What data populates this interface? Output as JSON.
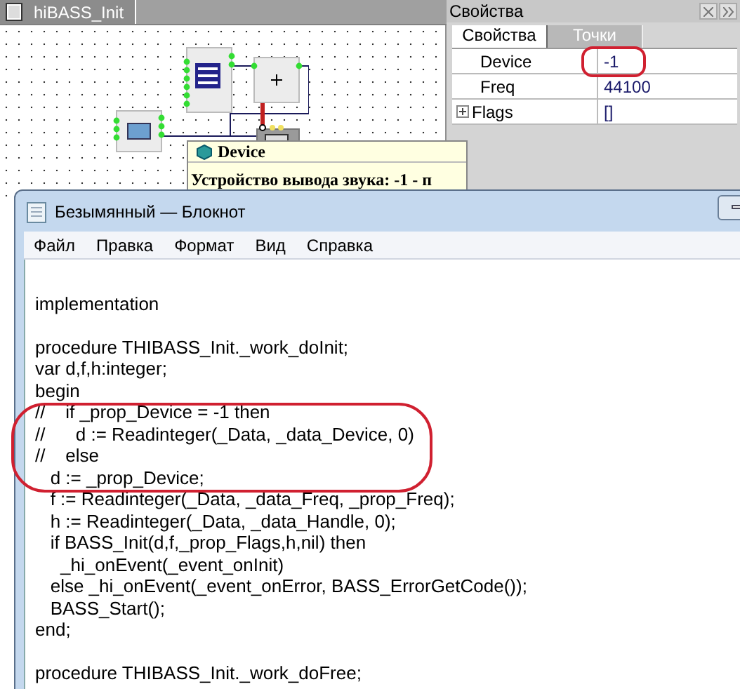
{
  "editor_tab": {
    "label": "hiBASS_Init",
    "selected": true
  },
  "properties_panel": {
    "title": "Свойства",
    "tabs": [
      {
        "label": "Свойства",
        "selected": true
      },
      {
        "label": "Точки",
        "selected": false
      }
    ],
    "rows": [
      {
        "name": "Device",
        "value": "-1",
        "expandable": false
      },
      {
        "name": "Freq",
        "value": "44100",
        "expandable": false
      },
      {
        "name": "Flags",
        "value": "[]",
        "expandable": true
      }
    ]
  },
  "tooltip": {
    "title": "Device",
    "text": "Устройство вывода звука: -1 - п"
  },
  "notepad": {
    "title": "Безымянный — Блокнот",
    "menu": [
      "Файл",
      "Правка",
      "Формат",
      "Вид",
      "Справка"
    ],
    "lines": [
      {
        "text": "implementation",
        "blank_before": true
      },
      {
        "text": "procedure THIBASS_Init._work_doInit;",
        "blank_before": true
      },
      {
        "text": "var d,f,h:integer;",
        "blank_before": false
      },
      {
        "text": "begin",
        "blank_before": false
      },
      {
        "text": "//    if _prop_Device = -1 then",
        "blank_before": false
      },
      {
        "text": "//      d := Readinteger(_Data, _data_Device, 0)",
        "blank_before": false
      },
      {
        "text": "//    else",
        "blank_before": false
      },
      {
        "text": "   d := _prop_Device;",
        "blank_before": false
      },
      {
        "text": "   f := Readinteger(_Data, _data_Freq, _prop_Freq);",
        "blank_before": false
      },
      {
        "text": "   h := Readinteger(_Data, _data_Handle, 0);",
        "blank_before": false
      },
      {
        "text": "   if BASS_Init(d,f,_prop_Flags,h,nil) then",
        "blank_before": false
      },
      {
        "text": "     _hi_onEvent(_event_onInit)",
        "blank_before": false
      },
      {
        "text": "   else _hi_onEvent(_event_onError, BASS_ErrorGetCode());",
        "blank_before": false
      },
      {
        "text": "   BASS_Start();",
        "blank_before": false
      },
      {
        "text": "end;",
        "blank_before": false
      },
      {
        "text": "procedure THIBASS_Init._work_doFree;",
        "blank_before": true
      }
    ]
  }
}
